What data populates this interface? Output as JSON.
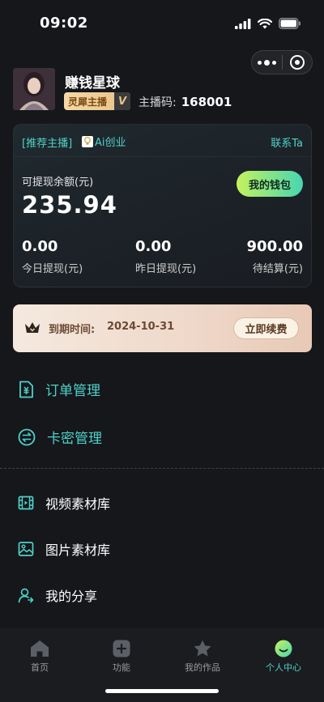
{
  "status_bar": {
    "time": "09:02"
  },
  "profile": {
    "shop_name": "赚钱星球",
    "badge_label": "灵犀主播",
    "badge_mark": "V",
    "anchor_code_label": "主播码:",
    "anchor_code": "168001"
  },
  "wallet": {
    "recommend_label": "[推荐主播]",
    "recommend_name": "Ai创业",
    "contact_label": "联系Ta",
    "balance_label": "可提现余额(元)",
    "balance_value": "235.94",
    "wallet_button": "我的钱包",
    "stats": [
      {
        "value": "0.00",
        "label": "今日提现(元)"
      },
      {
        "value": "0.00",
        "label": "昨日提现(元)"
      },
      {
        "value": "900.00",
        "label": "待结算(元)"
      }
    ]
  },
  "expiry": {
    "label": "到期时间:",
    "date": "2024-10-31",
    "renew_button": "立即续费"
  },
  "menu": {
    "primary": [
      {
        "label": "订单管理",
        "icon": "order-doc-icon"
      },
      {
        "label": "卡密管理",
        "icon": "exchange-icon"
      }
    ],
    "secondary": [
      {
        "label": "视频素材库",
        "icon": "film-icon"
      },
      {
        "label": "图片素材库",
        "icon": "image-icon"
      },
      {
        "label": "我的分享",
        "icon": "share-user-icon"
      }
    ]
  },
  "tabbar": {
    "items": [
      {
        "label": "首页",
        "icon": "home-icon"
      },
      {
        "label": "功能",
        "icon": "plus-square-icon"
      },
      {
        "label": "我的作品",
        "icon": "star-icon"
      },
      {
        "label": "个人中心",
        "icon": "smile-icon"
      }
    ],
    "active_index": 3
  },
  "colors": {
    "background": "#15171b",
    "accent_teal": "#4fd1c8",
    "wallet_button_start": "#c6f25e",
    "wallet_button_end": "#46d6b0",
    "badge_gold": "#f5d9a6",
    "expiry_bg": "#f5e9df"
  }
}
